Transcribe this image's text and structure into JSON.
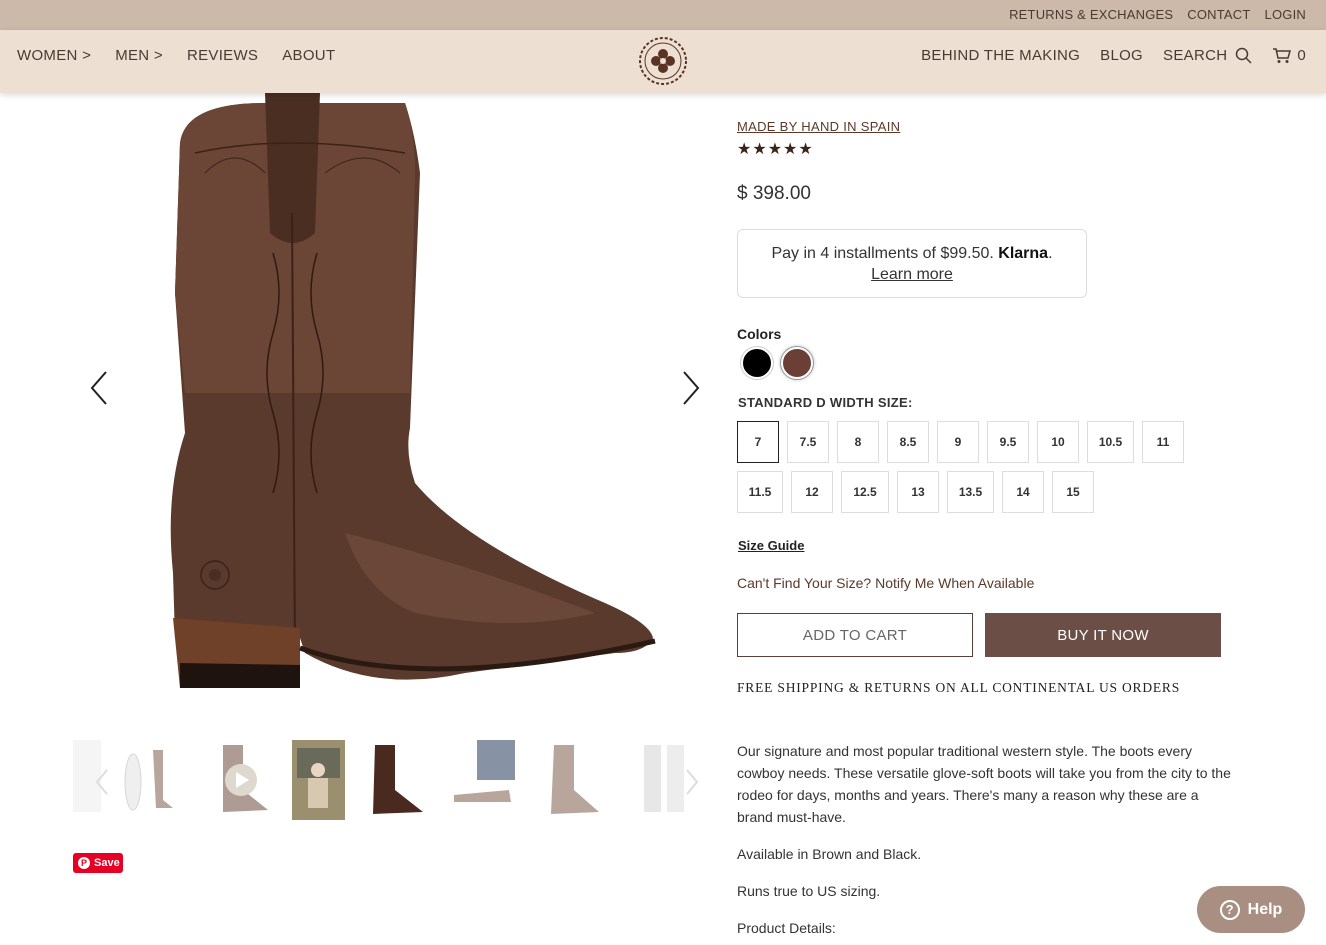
{
  "topbar": {
    "returns": "RETURNS & EXCHANGES",
    "contact": "CONTACT",
    "login": "LOGIN"
  },
  "nav": {
    "women": "WOMEN >",
    "men": "MEN >",
    "reviews": "REVIEWS",
    "about": "ABOUT",
    "behind": "BEHIND THE MAKING",
    "blog": "BLOG",
    "search": "SEARCH",
    "cart_count": "0"
  },
  "product": {
    "made": "MADE BY HAND IN SPAIN",
    "stars": "★★★★★",
    "rating_stars": 5,
    "price": "$ 398.00",
    "klarna_text": "Pay in 4 installments of $99.50. ",
    "klarna_brand": "Klarna",
    "klarna_dot": ".",
    "klarna_learn": "Learn more",
    "colors_label": "Colors",
    "colors": [
      "#000000",
      "#6b3f35"
    ],
    "size_label": "STANDARD D WIDTH SIZE:",
    "sizes_row1": [
      "7",
      "7.5",
      "8",
      "8.5",
      "9",
      "9.5",
      "10",
      "10.5",
      "11"
    ],
    "sizes_row2": [
      "11.5",
      "12",
      "12.5",
      "13",
      "13.5",
      "14",
      "15"
    ],
    "selected_size": "7",
    "size_guide": "Size Guide",
    "notify": "Can't Find Your Size? Notify Me When Available",
    "add_to_cart": "ADD TO CART",
    "buy_now": "BUY IT NOW",
    "shipping": "FREE SHIPPING & RETURNS ON ALL CONTINENTAL US ORDERS",
    "desc1": "Our signature and most popular traditional western style. The boots every cowboy needs. These versatile glove-soft boots will take you from the city to the rodeo for days, months and years. There's many a reason why these are a brand must-have.",
    "desc2": "Available in Brown and Black.",
    "desc3": "Runs true to US sizing.",
    "desc4": "Product Details:"
  },
  "pin": {
    "save": "Save"
  },
  "help": {
    "label": "Help"
  }
}
